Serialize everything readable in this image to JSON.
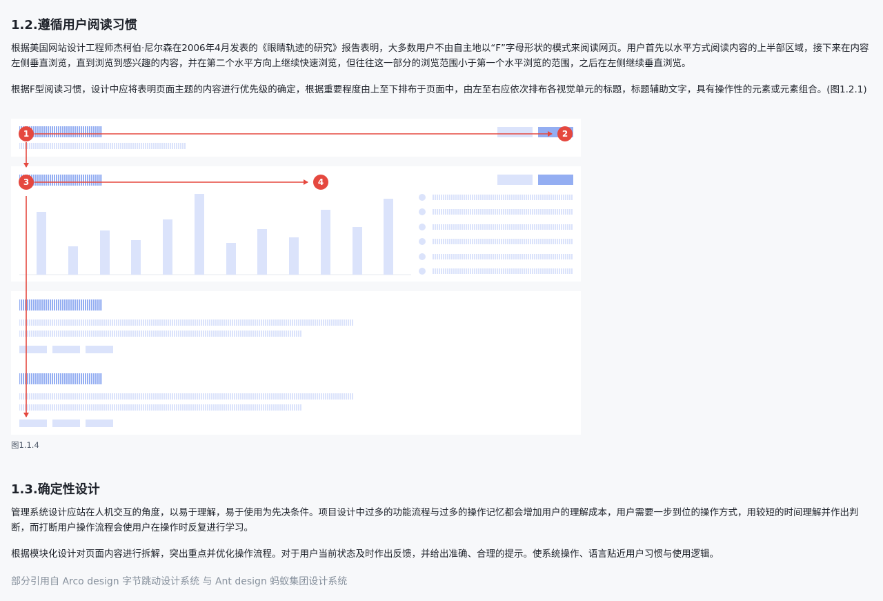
{
  "section1": {
    "title": "1.2.遵循用户阅读习惯",
    "para1": "根据美国网站设计工程师杰柯伯·尼尔森在2006年4月发表的《眼睛轨迹的研究》报告表明，大多数用户不由自主地以“F”字母形状的模式来阅读网页。用户首先以水平方式阅读内容的上半部区域，接下来在内容左侧垂直浏览，直到浏览到感兴趣的内容，并在第二个水平方向上继续快速浏览，但往往这一部分的浏览范围小于第一个水平浏览的范围，之后在左侧继续垂直浏览。",
    "para2": "根据F型阅读习惯，设计中应将表明页面主题的内容进行优先级的确定，根据重要程度由上至下排布于页面中，由左至右应依次排布各视觉单元的标题，标题辅助文字，具有操作性的元素或元素组合。(图1.2.1)"
  },
  "figure": {
    "markers": [
      "1",
      "2",
      "3",
      "4"
    ],
    "caption": "图1.1.4",
    "colors": {
      "arrow": "#e5483f",
      "bar_light": "#dbe3fb",
      "bar_primary": "#94aef2",
      "stripe": "#d7dff6",
      "panel": "#ffffff"
    }
  },
  "section2": {
    "title": "1.3.确定性设计",
    "para1": "管理系统设计应站在人机交互的角度，以易于理解，易于使用为先决条件。项目设计中过多的功能流程与过多的操作记忆都会增加用户的理解成本，用户需要一步到位的操作方式，用较短的时间理解并作出判断，而打断用户操作流程会使用户在操作时反复进行学习。",
    "para2": "根据模块化设计对页面内容进行拆解，突出重点并优化操作流程。对于用户当前状态及时作出反馈，并给出准确、合理的提示。使系统操作、语言贴近用户习惯与使用逻辑。"
  },
  "footnote": "部分引用自 Arco design 字节跳动设计系统 与 Ant design 蚂蚁集团设计系统"
}
